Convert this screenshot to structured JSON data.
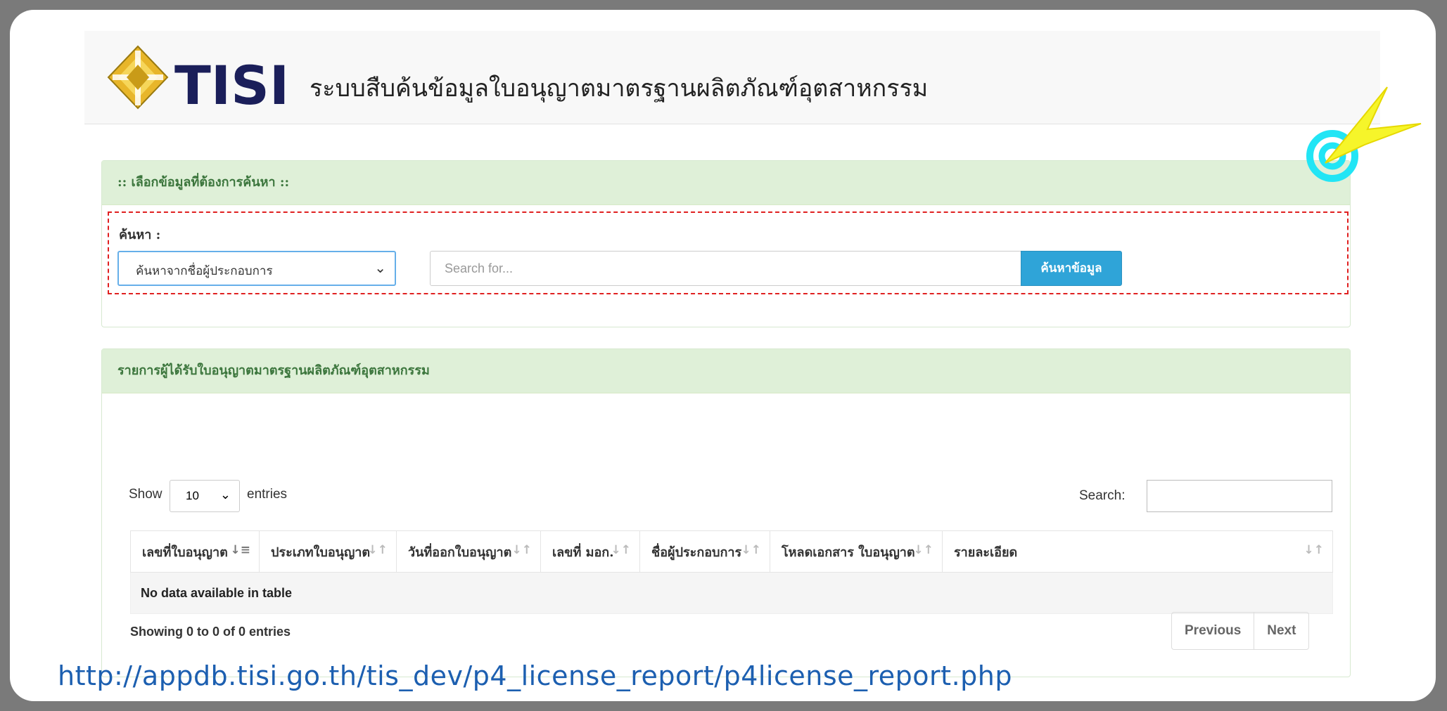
{
  "header": {
    "logo_text": "TISI",
    "title": "ระบบสืบค้นข้อมูลใบอนุญาตมาตรฐานผลิตภัณฑ์อุตสาหกรรม"
  },
  "search_panel": {
    "heading": ":: เลือกข้อมูลที่ต้องการค้นหา ::",
    "label": "ค้นหา :",
    "select_value": "ค้นหาจากชื่อผู้ประกอบการ",
    "input_placeholder": "Search for...",
    "button_label": "ค้นหาข้อมูล"
  },
  "results_panel": {
    "heading": "รายการผู้ได้รับใบอนุญาตมาตรฐานผลิตภัณฑ์อุตสาหกรรม",
    "show_label": "Show",
    "entries_value": "10",
    "entries_label": "entries",
    "filter_label": "Search:",
    "columns": [
      "เลขที่ใบอนุญาต",
      "ประเภทใบอนุญาต",
      "วันที่ออกใบอนุญาต",
      "เลขที่ มอก.",
      "ชื่อผู้ประกอบการ",
      "โหลดเอกสาร ใบอนุญาต",
      "รายละเอียด"
    ],
    "empty_message": "No data available in table",
    "info": "Showing 0 to 0 of 0 entries",
    "prev_label": "Previous",
    "next_label": "Next"
  },
  "footer_url": "http://appdb.tisi.go.th/tis_dev/p4_license_report/p4license_report.php",
  "colors": {
    "panel_heading_bg": "#dff0d8",
    "panel_heading_text": "#3c763d",
    "button_bg": "#2fa4d8",
    "highlight_border": "#e02020",
    "logo_gold": "#e8b62a",
    "logo_navy": "#1b1f5a"
  }
}
